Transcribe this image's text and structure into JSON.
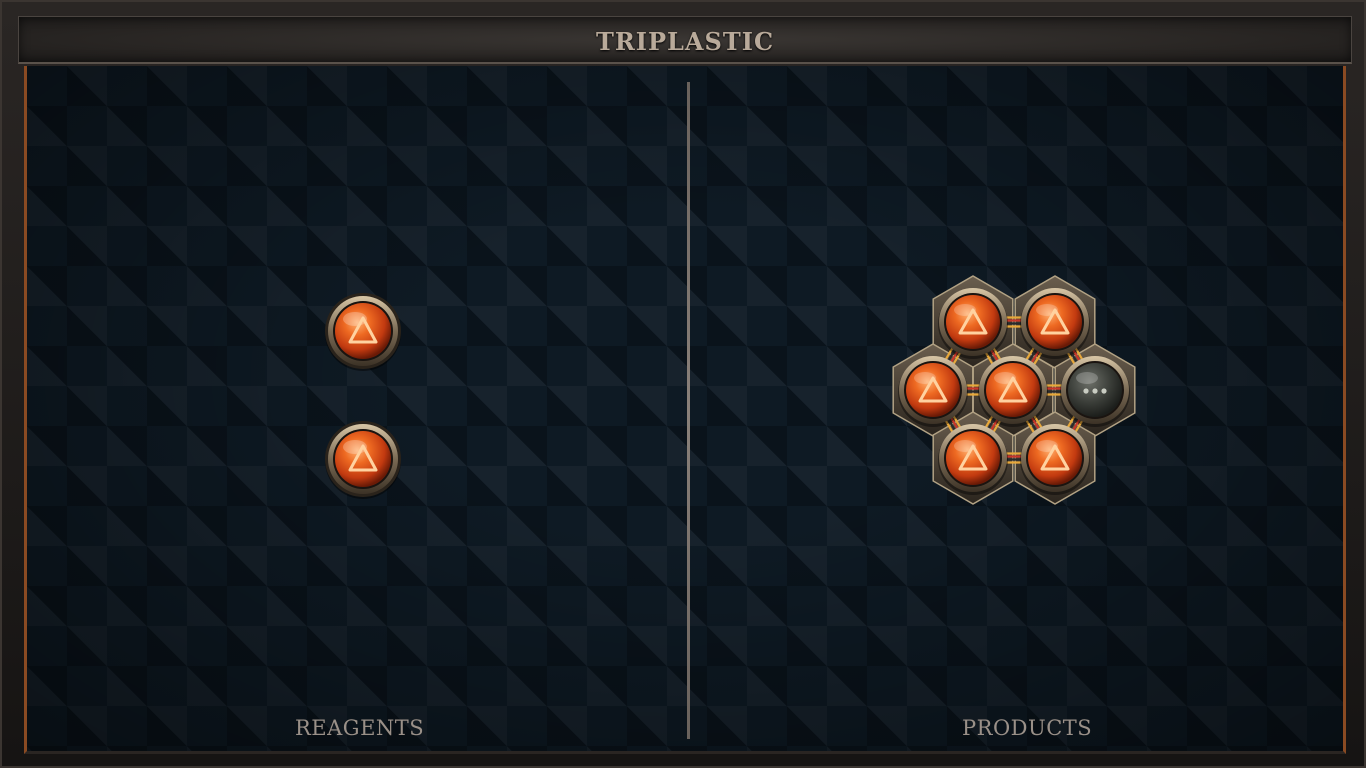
{
  "title": "TRIPLASTIC",
  "panels": {
    "reagents_label": "REAGENTS",
    "products_label": "PRODUCTS"
  },
  "reagents": [
    {
      "element": "fire",
      "icon": "fire-triangle-icon"
    },
    {
      "element": "fire",
      "icon": "fire-triangle-icon"
    }
  ],
  "product": {
    "atoms": [
      {
        "element": "fire",
        "icon": "fire-triangle-icon"
      },
      {
        "element": "fire",
        "icon": "fire-triangle-icon"
      },
      {
        "element": "fire",
        "icon": "fire-triangle-icon"
      },
      {
        "element": "fire",
        "icon": "fire-triangle-icon"
      },
      {
        "element": "salt-or-quicksilver-unknown",
        "icon": "ellipsis-icon"
      },
      {
        "element": "fire",
        "icon": "fire-triangle-icon"
      },
      {
        "element": "fire",
        "icon": "fire-triangle-icon"
      }
    ]
  },
  "colors": {
    "fire_orb": "#e0541a",
    "fire_glow": "#ff8a3a",
    "rim": "#8a7a64",
    "board": "#0e1a24",
    "border_accent": "#8a4a22",
    "label": "#9a9088"
  }
}
